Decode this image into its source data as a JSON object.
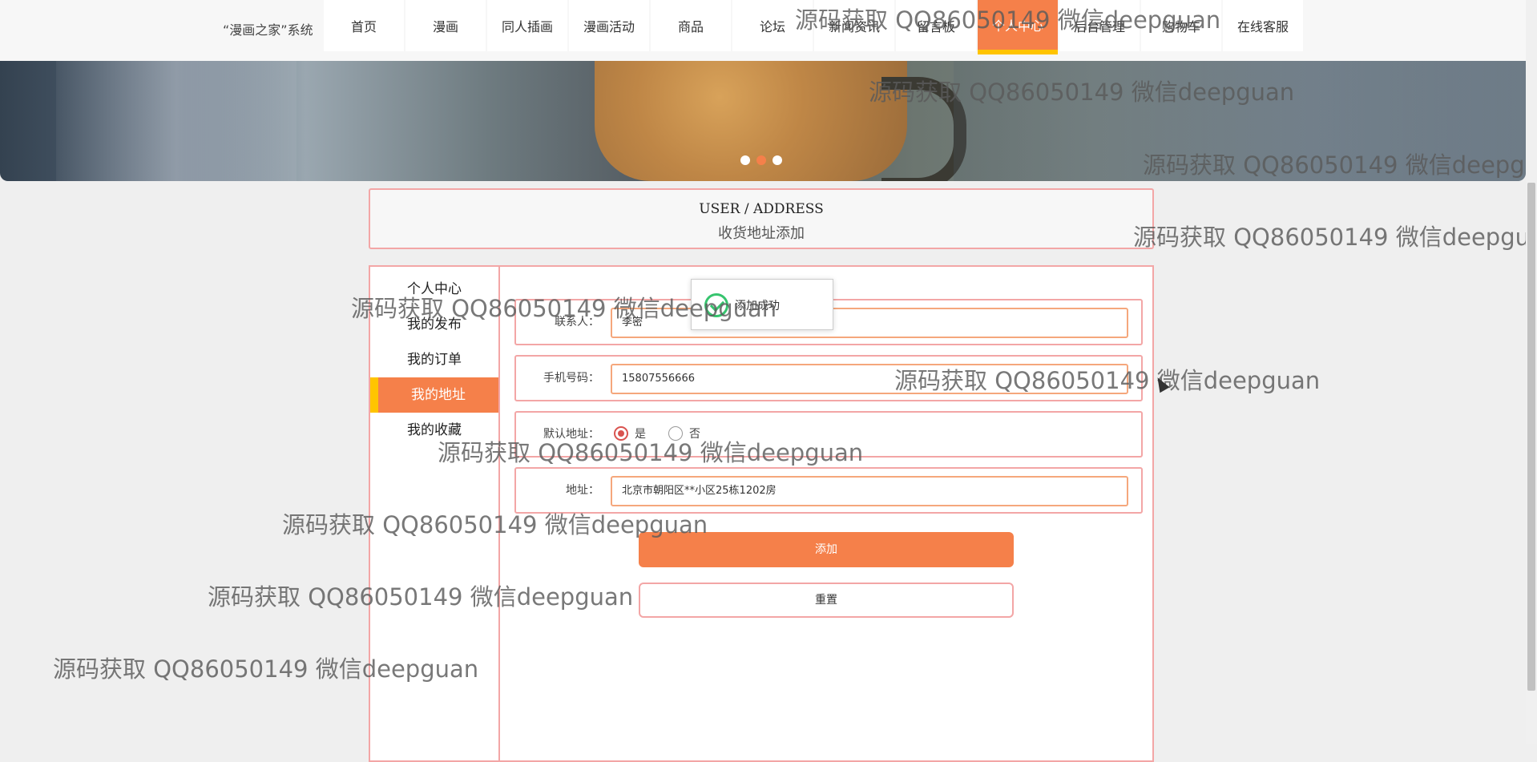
{
  "site": {
    "name": "“漫画之家”系统"
  },
  "nav": {
    "items": [
      {
        "label": "首页"
      },
      {
        "label": "漫画"
      },
      {
        "label": "同人插画"
      },
      {
        "label": "漫画活动"
      },
      {
        "label": "商品"
      },
      {
        "label": "论坛"
      },
      {
        "label": "新闻资讯"
      },
      {
        "label": "留言板"
      },
      {
        "label": "个人中心"
      },
      {
        "label": "后台管理"
      },
      {
        "label": "购物车"
      },
      {
        "label": "在线客服"
      }
    ],
    "active_index": 8
  },
  "banner": {
    "slide_count": 3,
    "active_slide": 2
  },
  "page": {
    "title_en": "USER / ADDRESS",
    "title_cn": "收货地址添加"
  },
  "sidebar": {
    "items": [
      {
        "label": "个人中心"
      },
      {
        "label": "我的发布"
      },
      {
        "label": "我的订单"
      },
      {
        "label": "我的地址"
      },
      {
        "label": "我的收藏"
      }
    ],
    "active_index": 3
  },
  "form": {
    "contact": {
      "label": "联系人：",
      "value": "李密"
    },
    "phone": {
      "label": "手机号码：",
      "value": "15807556666"
    },
    "default_address": {
      "label": "默认地址：",
      "options": [
        "是",
        "否"
      ],
      "selected": "是"
    },
    "address": {
      "label": "地址：",
      "value": "北京市朝阳区**小区25栋1202房"
    },
    "add_button": "添加",
    "reset_button": "重置"
  },
  "toast": {
    "text": "添加成功"
  },
  "watermark": {
    "text": "源码获取 QQ86050149 微信deepguan"
  },
  "colors": {
    "accent": "#f5804a",
    "highlight": "#ffc400",
    "border": "#f3a6a6",
    "success": "#36c46e"
  }
}
